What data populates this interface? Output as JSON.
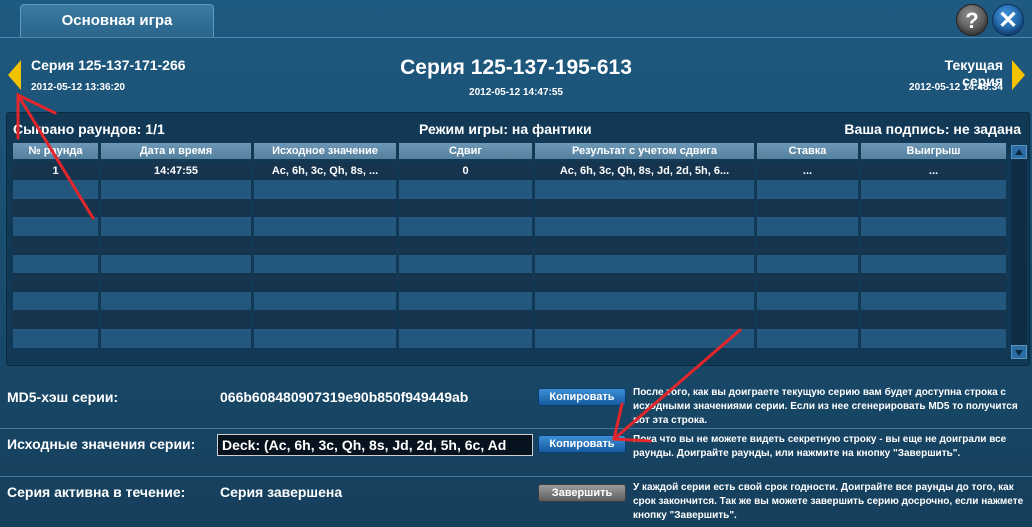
{
  "tab": {
    "label": "Основная игра"
  },
  "controls": {
    "help_glyph": "?",
    "close_glyph": "✕"
  },
  "prev_series": {
    "name": "Серия 125-137-171-266",
    "date": "2012-05-12 13:36:20"
  },
  "current_series": {
    "name": "Серия 125-137-195-613",
    "date": "2012-05-12 14:47:55"
  },
  "next_series": {
    "name": "Текущая серия",
    "date": "2012-05-12 14:48:34"
  },
  "info": {
    "rounds": "Сыграно раундов: 1/1",
    "mode": "Режим игры: на фантики",
    "signature": "Ваша подпись: не задана"
  },
  "table": {
    "columns": [
      "№ раунда",
      "Дата и время",
      "Исходное значение",
      "Сдвиг",
      "Результат с учетом сдвига",
      "Ставка",
      "Выигрыш"
    ],
    "rows": [
      [
        "1",
        "14:47:55",
        "Ac, 6h, 3c, Qh, 8s, ...",
        "0",
        "Ac, 6h, 3c, Qh, 8s, Jd, 2d, 5h, 6...",
        "...",
        "..."
      ]
    ]
  },
  "md5": {
    "label": "MD5-хэш серии:",
    "value": "066b608480907319e90b850f949449ab",
    "button": "Копировать",
    "hint": "После того, как вы доиграете текущую серию вам будет доступна строка с исходными значениями серии. Если из нее сгенерировать MD5 то получится вот эта строка."
  },
  "source": {
    "label": "Исходные значения серии:",
    "value": "Deck: (Ac, 6h, 3c, Qh, 8s, Jd, 2d, 5h, 6c, Ad",
    "button": "Копировать",
    "hint": "Пока что вы не можете видеть секретную строку - вы еще не доиграли все раунды. Доиграйте раунды, или нажмите на кнопку \"Завершить\"."
  },
  "active": {
    "label": "Серия активна в течение:",
    "value": "Серия завершена",
    "button": "Завершить",
    "hint": "У каждой серии есть свой срок годности. Доиграйте все раунды до того, как срок закончится. Так же вы можете завершить серию досрочно, если нажмете кнопку \"Завершить\"."
  },
  "colors": {
    "background": "#1a4a6c",
    "arrow_nav": "#f3c300",
    "annotation_arrow": "#e3262b"
  }
}
